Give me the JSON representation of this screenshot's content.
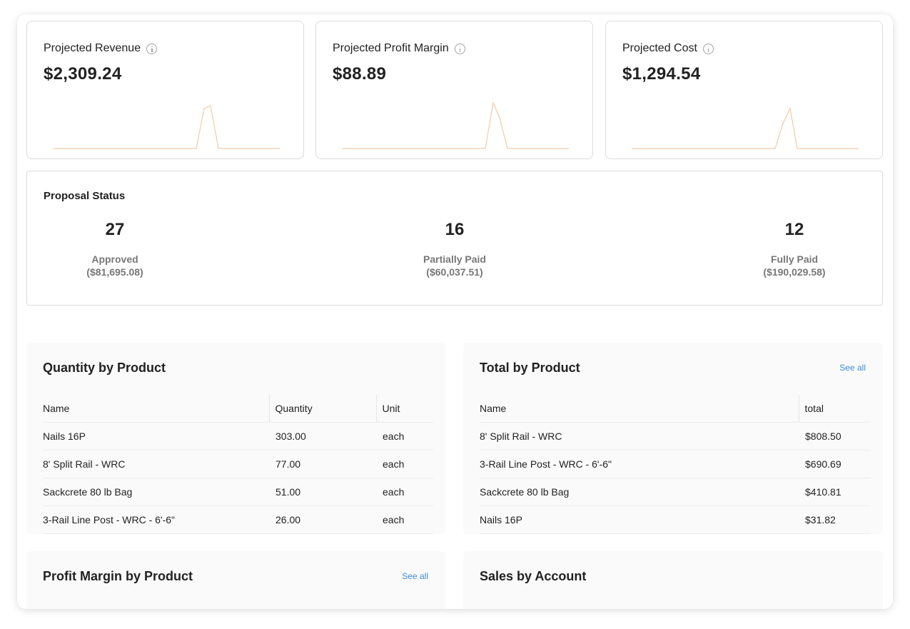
{
  "metrics": [
    {
      "title": "Projected Revenue",
      "value": "$2,309.24"
    },
    {
      "title": "Projected Profit Margin",
      "value": "$88.89"
    },
    {
      "title": "Projected Cost",
      "value": "$1,294.54"
    }
  ],
  "proposal_status": {
    "title": "Proposal Status",
    "items": [
      {
        "count": "27",
        "label": "Approved",
        "amount": "($81,695.08)"
      },
      {
        "count": "16",
        "label": "Partially Paid",
        "amount": "($60,037.51)"
      },
      {
        "count": "12",
        "label": "Fully Paid",
        "amount": "($190,029.58)"
      }
    ]
  },
  "quantity_by_product": {
    "title": "Quantity by Product",
    "columns": [
      "Name",
      "Quantity",
      "Unit"
    ],
    "rows": [
      [
        "Nails 16P",
        "303.00",
        "each"
      ],
      [
        "8' Split Rail - WRC",
        "77.00",
        "each"
      ],
      [
        "Sackcrete 80 lb Bag",
        "51.00",
        "each"
      ],
      [
        "3-Rail Line Post - WRC - 6'-6\"",
        "26.00",
        "each"
      ]
    ]
  },
  "total_by_product": {
    "title": "Total by Product",
    "see_all": "See all",
    "columns": [
      "Name",
      "total"
    ],
    "rows": [
      [
        "8' Split Rail - WRC",
        "$808.50"
      ],
      [
        "3-Rail Line Post - WRC - 6'-6\"",
        "$690.69"
      ],
      [
        "Sackcrete 80 lb Bag",
        "$410.81"
      ],
      [
        "Nails 16P",
        "$31.82"
      ]
    ]
  },
  "profit_margin_by_product": {
    "title": "Profit Margin by Product",
    "see_all": "See all"
  },
  "sales_by_account": {
    "title": "Sales by Account"
  },
  "colors": {
    "sparkline": "#f6c9a6",
    "link": "#3a8ddb",
    "border": "#dcdcdc"
  }
}
